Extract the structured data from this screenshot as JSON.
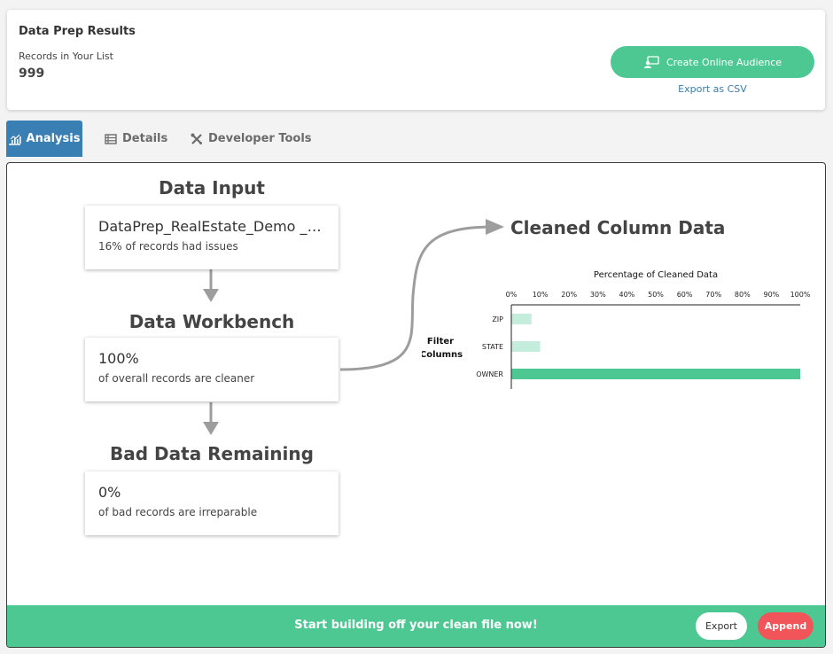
{
  "header": {
    "title": "Data Prep Results",
    "records_label": "Records in Your List",
    "records_value": "999",
    "create_audience_label": "Create Online Audience",
    "export_csv_label": "Export as CSV"
  },
  "tabs": [
    {
      "label": "Analysis",
      "icon": "chart-icon",
      "active": true
    },
    {
      "label": "Details",
      "icon": "list-icon",
      "active": false
    },
    {
      "label": "Developer Tools",
      "icon": "tools-icon",
      "active": false
    }
  ],
  "flow": {
    "input_title": "Data Input",
    "input_main": "DataPrep_RealEstate_Demo _1...",
    "input_sub": "16% of records had issues",
    "workbench_title": "Data Workbench",
    "workbench_main": "100%",
    "workbench_sub": "of overall records are cleaner",
    "bad_title": "Bad Data Remaining",
    "bad_main": "0%",
    "bad_sub": "of bad records are irreparable"
  },
  "cleaned": {
    "title": "Cleaned Column Data"
  },
  "chart_data": {
    "type": "bar",
    "orientation": "horizontal",
    "title": "Percentage of Cleaned Data",
    "ylabel": "Filter Columns",
    "xlabel": "",
    "categories": [
      "ZIP",
      "STATE",
      "OWNER"
    ],
    "values": [
      7,
      10,
      100
    ],
    "xlim": [
      0,
      100
    ],
    "xticks": [
      "0%",
      "10%",
      "20%",
      "30%",
      "40%",
      "50%",
      "60%",
      "70%",
      "80%",
      "90%",
      "100%"
    ],
    "colors": [
      "#c4eedb",
      "#c4eedb",
      "#4ec893"
    ]
  },
  "footer": {
    "message": "Start building off your clean file now!",
    "export_label": "Export",
    "append_label": "Append"
  },
  "colors": {
    "accent_green": "#4ec893",
    "tab_blue": "#3a7fb3",
    "append_red": "#f25559",
    "link_blue": "#3b7dab"
  }
}
